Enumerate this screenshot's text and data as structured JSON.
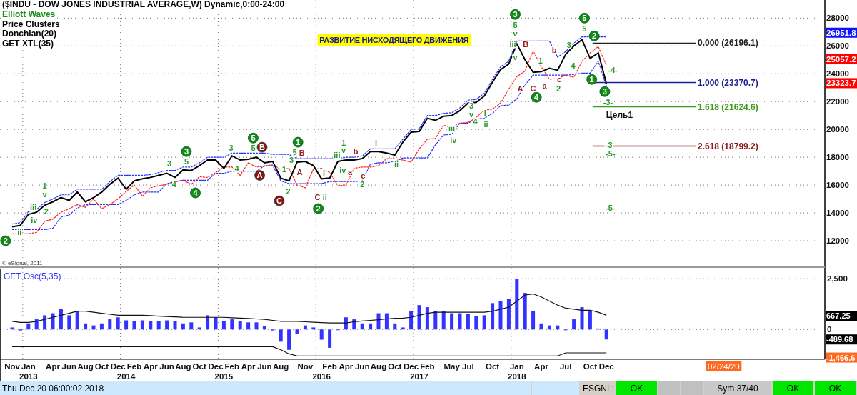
{
  "window": {
    "title": "($INDU - DOW JONES INDUSTRIAL AVERAGE,W) Dynamic,0:00-24:00"
  },
  "legend": [
    {
      "text": "Elliott Waves",
      "color": "#1e8c1e"
    },
    {
      "text": "Price Clusters",
      "color": "#000000"
    },
    {
      "text": "Donchian(20)",
      "color": "#000000"
    },
    {
      "text": "GET XTL(35)",
      "color": "#000000"
    }
  ],
  "price_panel": {
    "copyright": "© eSignal, 2011",
    "banner": "РАЗВИТИЕ НИСХОДЯЩЕГО ДВИЖЕНИЯ",
    "wave_labels": [
      {
        "kind": "circle-green",
        "text": "2"
      },
      {
        "kind": "green",
        "text": "ii"
      },
      {
        "kind": "green",
        "text": "iii"
      },
      {
        "kind": "green",
        "text": "iv"
      },
      {
        "kind": "green",
        "text": "1"
      },
      {
        "kind": "green",
        "text": "v"
      },
      {
        "kind": "green",
        "text": "2"
      },
      {
        "kind": "green",
        "text": "3"
      },
      {
        "kind": "green",
        "text": "4"
      },
      {
        "kind": "circle-green",
        "text": "3"
      },
      {
        "kind": "green",
        "text": "5"
      },
      {
        "kind": "circle-green",
        "text": "4"
      },
      {
        "kind": "green",
        "text": "3"
      },
      {
        "kind": "green",
        "text": "4"
      },
      {
        "kind": "circle-green",
        "text": "5"
      },
      {
        "kind": "green",
        "text": "5"
      },
      {
        "kind": "circle-red",
        "text": "A"
      },
      {
        "kind": "circle-red",
        "text": "B"
      },
      {
        "kind": "circle-red",
        "text": "C"
      },
      {
        "kind": "green",
        "text": "1"
      },
      {
        "kind": "green",
        "text": "2"
      },
      {
        "kind": "green",
        "text": "3"
      },
      {
        "kind": "green",
        "text": "5"
      },
      {
        "kind": "circle-green",
        "text": "1"
      },
      {
        "kind": "red",
        "text": "B"
      },
      {
        "kind": "red",
        "text": "A"
      },
      {
        "kind": "circle-green",
        "text": "2"
      },
      {
        "kind": "red",
        "text": "C"
      },
      {
        "kind": "green",
        "text": "i"
      },
      {
        "kind": "green",
        "text": "ii"
      },
      {
        "kind": "green",
        "text": "iii"
      },
      {
        "kind": "green",
        "text": "1"
      },
      {
        "kind": "green",
        "text": "v"
      },
      {
        "kind": "green",
        "text": "iv"
      },
      {
        "kind": "red",
        "text": "a"
      },
      {
        "kind": "red",
        "text": "b"
      },
      {
        "kind": "green",
        "text": "2"
      },
      {
        "kind": "red",
        "text": "c"
      },
      {
        "kind": "green",
        "text": "i"
      },
      {
        "kind": "green",
        "text": "ii"
      },
      {
        "kind": "green",
        "text": "iii"
      },
      {
        "kind": "green",
        "text": "iv"
      },
      {
        "kind": "green",
        "text": "3"
      },
      {
        "kind": "green",
        "text": "v"
      },
      {
        "kind": "green",
        "text": "4"
      },
      {
        "kind": "green",
        "text": "i"
      },
      {
        "kind": "green",
        "text": "ii"
      },
      {
        "kind": "green",
        "text": "iii"
      },
      {
        "kind": "circle-green",
        "text": "3"
      },
      {
        "kind": "green",
        "text": "5"
      },
      {
        "kind": "green",
        "text": "v"
      },
      {
        "kind": "green",
        "text": "v"
      },
      {
        "kind": "red",
        "text": "A"
      },
      {
        "kind": "red",
        "text": "B"
      },
      {
        "kind": "red",
        "text": "C"
      },
      {
        "kind": "circle-green",
        "text": "4"
      },
      {
        "kind": "green",
        "text": "1"
      },
      {
        "kind": "red",
        "text": "a"
      },
      {
        "kind": "red",
        "text": "b"
      },
      {
        "kind": "green",
        "text": "2"
      },
      {
        "kind": "red",
        "text": "c"
      },
      {
        "kind": "green",
        "text": "3"
      },
      {
        "kind": "green",
        "text": "4"
      },
      {
        "kind": "circle-green",
        "text": "5"
      },
      {
        "kind": "green",
        "text": "5"
      },
      {
        "kind": "circle-green",
        "text": "1"
      },
      {
        "kind": "circle-green",
        "text": "2"
      },
      {
        "kind": "green",
        "text": "-4-"
      },
      {
        "kind": "circle-green",
        "text": "3"
      },
      {
        "kind": "green",
        "text": "-3-"
      },
      {
        "kind": "target",
        "text": "Цель1"
      },
      {
        "kind": "green",
        "text": "-3"
      },
      {
        "kind": "green",
        "text": "-5-"
      },
      {
        "kind": "green",
        "text": "-5-"
      }
    ],
    "price_badges": [
      {
        "text": "26951.8",
        "color": "#1010ff"
      },
      {
        "text": "25057.2",
        "color": "#ff0000"
      },
      {
        "text": "23323.7",
        "color": "#ff0000"
      }
    ],
    "chart_data": {
      "type": "line",
      "grid": true,
      "series": [
        {
          "color": "#000000",
          "values": [
            13000,
            13100,
            13900,
            14050,
            14550,
            14800,
            15100,
            14900,
            15500,
            14800,
            15100,
            15500,
            16050,
            16500,
            15700,
            16300,
            16450,
            16550,
            16700,
            16850,
            16550,
            17100,
            17050,
            17400,
            17800,
            17800,
            17200,
            18100,
            17800,
            17850,
            18000,
            17600,
            17700,
            16500,
            16300,
            17650,
            17700,
            17400,
            16450,
            16500,
            17700,
            17800,
            17800,
            17900,
            18400,
            18400,
            18300,
            18150,
            19100,
            19800,
            19850,
            20800,
            20650,
            20950,
            21000,
            21350,
            21900,
            21950,
            22400,
            23400,
            24300,
            24700,
            26150,
            25000,
            24100,
            24150,
            24400,
            24250,
            25400,
            26000,
            26450,
            25100,
            25500,
            23300
          ]
        },
        {
          "color": "#2233ff",
          "line_style": "dashed",
          "values": [
            13200,
            13300,
            14100,
            14250,
            14750,
            15000,
            15300,
            15300,
            15700,
            15700,
            15700,
            15700,
            16250,
            16700,
            16700,
            16700,
            16700,
            16750,
            16900,
            17050,
            17050,
            17300,
            17300,
            17600,
            18000,
            18000,
            18000,
            18300,
            18300,
            18300,
            18300,
            18300,
            18200,
            18200,
            18200,
            17900,
            17900,
            17900,
            17900,
            17900,
            17900,
            18000,
            18000,
            18100,
            18600,
            18600,
            18600,
            18600,
            19300,
            20000,
            20050,
            21000,
            21000,
            21150,
            21200,
            21550,
            22100,
            22150,
            22600,
            23600,
            24500,
            24900,
            26350,
            26350,
            26350,
            26350,
            26350,
            25200,
            25600,
            26200,
            26650,
            26650,
            26650,
            26650
          ]
        },
        {
          "color": "#2233ff",
          "line_style": "dashed",
          "values": [
            12800,
            12800,
            12800,
            12800,
            12800,
            12900,
            13700,
            13850,
            14350,
            14600,
            14600,
            14600,
            14600,
            14600,
            14900,
            15300,
            15500,
            15500,
            15500,
            16100,
            16250,
            16350,
            16350,
            16350,
            16350,
            16850,
            16850,
            17000,
            17000,
            17000,
            17000,
            17400,
            17400,
            16300,
            16100,
            16100,
            16100,
            16100,
            16100,
            16250,
            16250,
            16250,
            16250,
            16300,
            17500,
            17600,
            17600,
            17700,
            17950,
            17950,
            17950,
            17950,
            18900,
            19600,
            19650,
            20450,
            20450,
            20750,
            20800,
            21150,
            21700,
            21750,
            22200,
            23200,
            23900,
            23900,
            23900,
            23900,
            23900,
            23950,
            24050,
            24050,
            24900,
            23100
          ]
        },
        {
          "color": "#ff2020",
          "line_style": "dashed",
          "values": [
            12500,
            12500,
            12500,
            12600,
            13400,
            13550,
            14050,
            14300,
            14600,
            14400,
            15000,
            14300,
            14600,
            15000,
            15550,
            16000,
            15200,
            15800,
            15950,
            16050,
            16200,
            16350,
            16050,
            16600,
            16550,
            16900,
            17300,
            17300,
            16700,
            17600,
            17300,
            17350,
            17500,
            17100,
            17200,
            16000,
            15800,
            17150,
            17200,
            16900,
            15950,
            16000,
            17200,
            17300,
            17300,
            17400,
            17900,
            17900,
            17800,
            17650,
            18600,
            19300,
            19350,
            20300,
            20150,
            20450,
            20500,
            20850,
            21400,
            21450,
            21900,
            22900,
            23800,
            24200,
            25650,
            24500,
            23600,
            23650,
            23900,
            23750,
            24900,
            25500,
            25950,
            24600
          ]
        }
      ],
      "ylim": [
        10000,
        29300
      ],
      "yticks": [
        12000,
        14000,
        16000,
        18000,
        20000,
        22000,
        24000,
        26000,
        28000
      ]
    },
    "fib_levels": [
      {
        "label": "0.000 (26196.1)",
        "color": "#222222"
      },
      {
        "label": "1.000 (23370.7)",
        "color": "#1c1c8c"
      },
      {
        "label": "1.618 (21624.6)",
        "color": "#3f9a1c"
      },
      {
        "label": "2.618 (18799.2)",
        "color": "#8b1a1a"
      }
    ]
  },
  "oscillator_panel": {
    "years": [
      "2013",
      "2014",
      "2015",
      "2016",
      "2017",
      "2018"
    ],
    "date_badge": {
      "text": "02/24/20",
      "color": "#ff6a22"
    },
    "badges": [
      {
        "text": "667.25",
        "color": "#000000"
      },
      {
        "text": "-489.68",
        "color": "#000000"
      },
      {
        "text": "-1,466.6",
        "color": "#ff6a22"
      }
    ],
    "chart_data": {
      "type": "bar",
      "grid": true,
      "categories": [
        "Nov",
        null,
        "Jan",
        null,
        null,
        "Apr",
        null,
        "Jun",
        null,
        "Aug",
        null,
        "Oct",
        null,
        "Dec",
        null,
        "Feb",
        null,
        "Apr",
        null,
        "Jun",
        null,
        "Aug",
        null,
        "Oct",
        null,
        "Dec",
        null,
        "Feb",
        null,
        "Apr",
        null,
        "Jun",
        null,
        "Aug",
        null,
        null,
        "Nov",
        null,
        null,
        "Feb",
        null,
        "Apr",
        null,
        "Jun",
        null,
        "Aug",
        null,
        "Oct",
        null,
        "Dec",
        null,
        "Feb",
        null,
        null,
        "May",
        null,
        "Jul",
        null,
        null,
        "Oct",
        null,
        null,
        "Jan",
        null,
        null,
        "Apr",
        null,
        null,
        "Jul",
        null,
        null,
        "Oct",
        null,
        "Dec"
      ],
      "series": [
        {
          "name": "GET Osc(5,35)",
          "color": "#3333ff",
          "values": [
            100,
            -50,
            300,
            500,
            700,
            800,
            1000,
            700,
            900,
            300,
            200,
            300,
            500,
            600,
            450,
            400,
            450,
            400,
            400,
            450,
            400,
            300,
            350,
            100,
            700,
            600,
            400,
            500,
            400,
            350,
            350,
            150,
            -50,
            -600,
            -1000,
            -200,
            200,
            100,
            -500,
            -900,
            0,
            600,
            500,
            300,
            300,
            800,
            800,
            300,
            100,
            900,
            1200,
            1100,
            900,
            900,
            800,
            800,
            750,
            650,
            700,
            1300,
            1400,
            1500,
            2500,
            1800,
            900,
            300,
            200,
            200,
            0,
            500,
            1100,
            900,
            50,
            -490
          ]
        },
        {
          "type": "line",
          "color": "#111111",
          "values": [
            400,
            350,
            350,
            400,
            500,
            600,
            700,
            800,
            900,
            900,
            850,
            800,
            750,
            700,
            700,
            700,
            700,
            680,
            660,
            640,
            620,
            600,
            600,
            600,
            600,
            600,
            600,
            580,
            560,
            540,
            520,
            500,
            450,
            400,
            400,
            400,
            380,
            360,
            340,
            320,
            320,
            320,
            380,
            420,
            450,
            480,
            520,
            550,
            560,
            600,
            700,
            800,
            850,
            850,
            850,
            850,
            850,
            850,
            850,
            900,
            1000,
            1100,
            1400,
            1700,
            1750,
            1600,
            1400,
            1200,
            1050,
            1000,
            950,
            950,
            850,
            700
          ]
        },
        {
          "type": "line",
          "color": "#111111",
          "values": [
            -850,
            -850,
            -850,
            -850,
            -850,
            -850,
            -850,
            -850,
            -850,
            -850,
            -850,
            -850,
            -850,
            -850,
            -850,
            -850,
            -850,
            -850,
            -850,
            -850,
            -850,
            -850,
            -850,
            -850,
            -850,
            -850,
            -850,
            -850,
            -850,
            -850,
            -850,
            -850,
            -850,
            -1000,
            -1200,
            -1300,
            -1300,
            -1300,
            -1300,
            -1300,
            -1300,
            -1300,
            -1300,
            -1300,
            -1300,
            -1300,
            -1300,
            -1300,
            -1300,
            -1300,
            -1300,
            -1300,
            -1300,
            -1300,
            -1300,
            -1300,
            -1300,
            -1300,
            -1300,
            -1300,
            -1300,
            -1300,
            -1300,
            -1300,
            -1300,
            -1300,
            -1300,
            -1300,
            -1150,
            -1150,
            -1150,
            -1150,
            -1150,
            -1150
          ]
        }
      ],
      "ylim": [
        -1466.6,
        3000
      ],
      "yticks": [
        {
          "value": 2500,
          "label": "2,500"
        },
        {
          "value": 0,
          "label": "0"
        }
      ]
    }
  },
  "status_bar": [
    {
      "kind": "date",
      "text": "Thu Dec 20 06:00:02 2018"
    },
    {
      "kind": "blank-blue"
    },
    {
      "kind": "label",
      "text": "ESGNL:"
    },
    {
      "kind": "ok",
      "text": "OK"
    },
    {
      "kind": "blank-grey"
    },
    {
      "kind": "blank-grey"
    },
    {
      "kind": "sym",
      "text": "Sym 37/40"
    },
    {
      "kind": "ok",
      "text": "OK"
    },
    {
      "kind": "ok",
      "text": "OK"
    }
  ]
}
